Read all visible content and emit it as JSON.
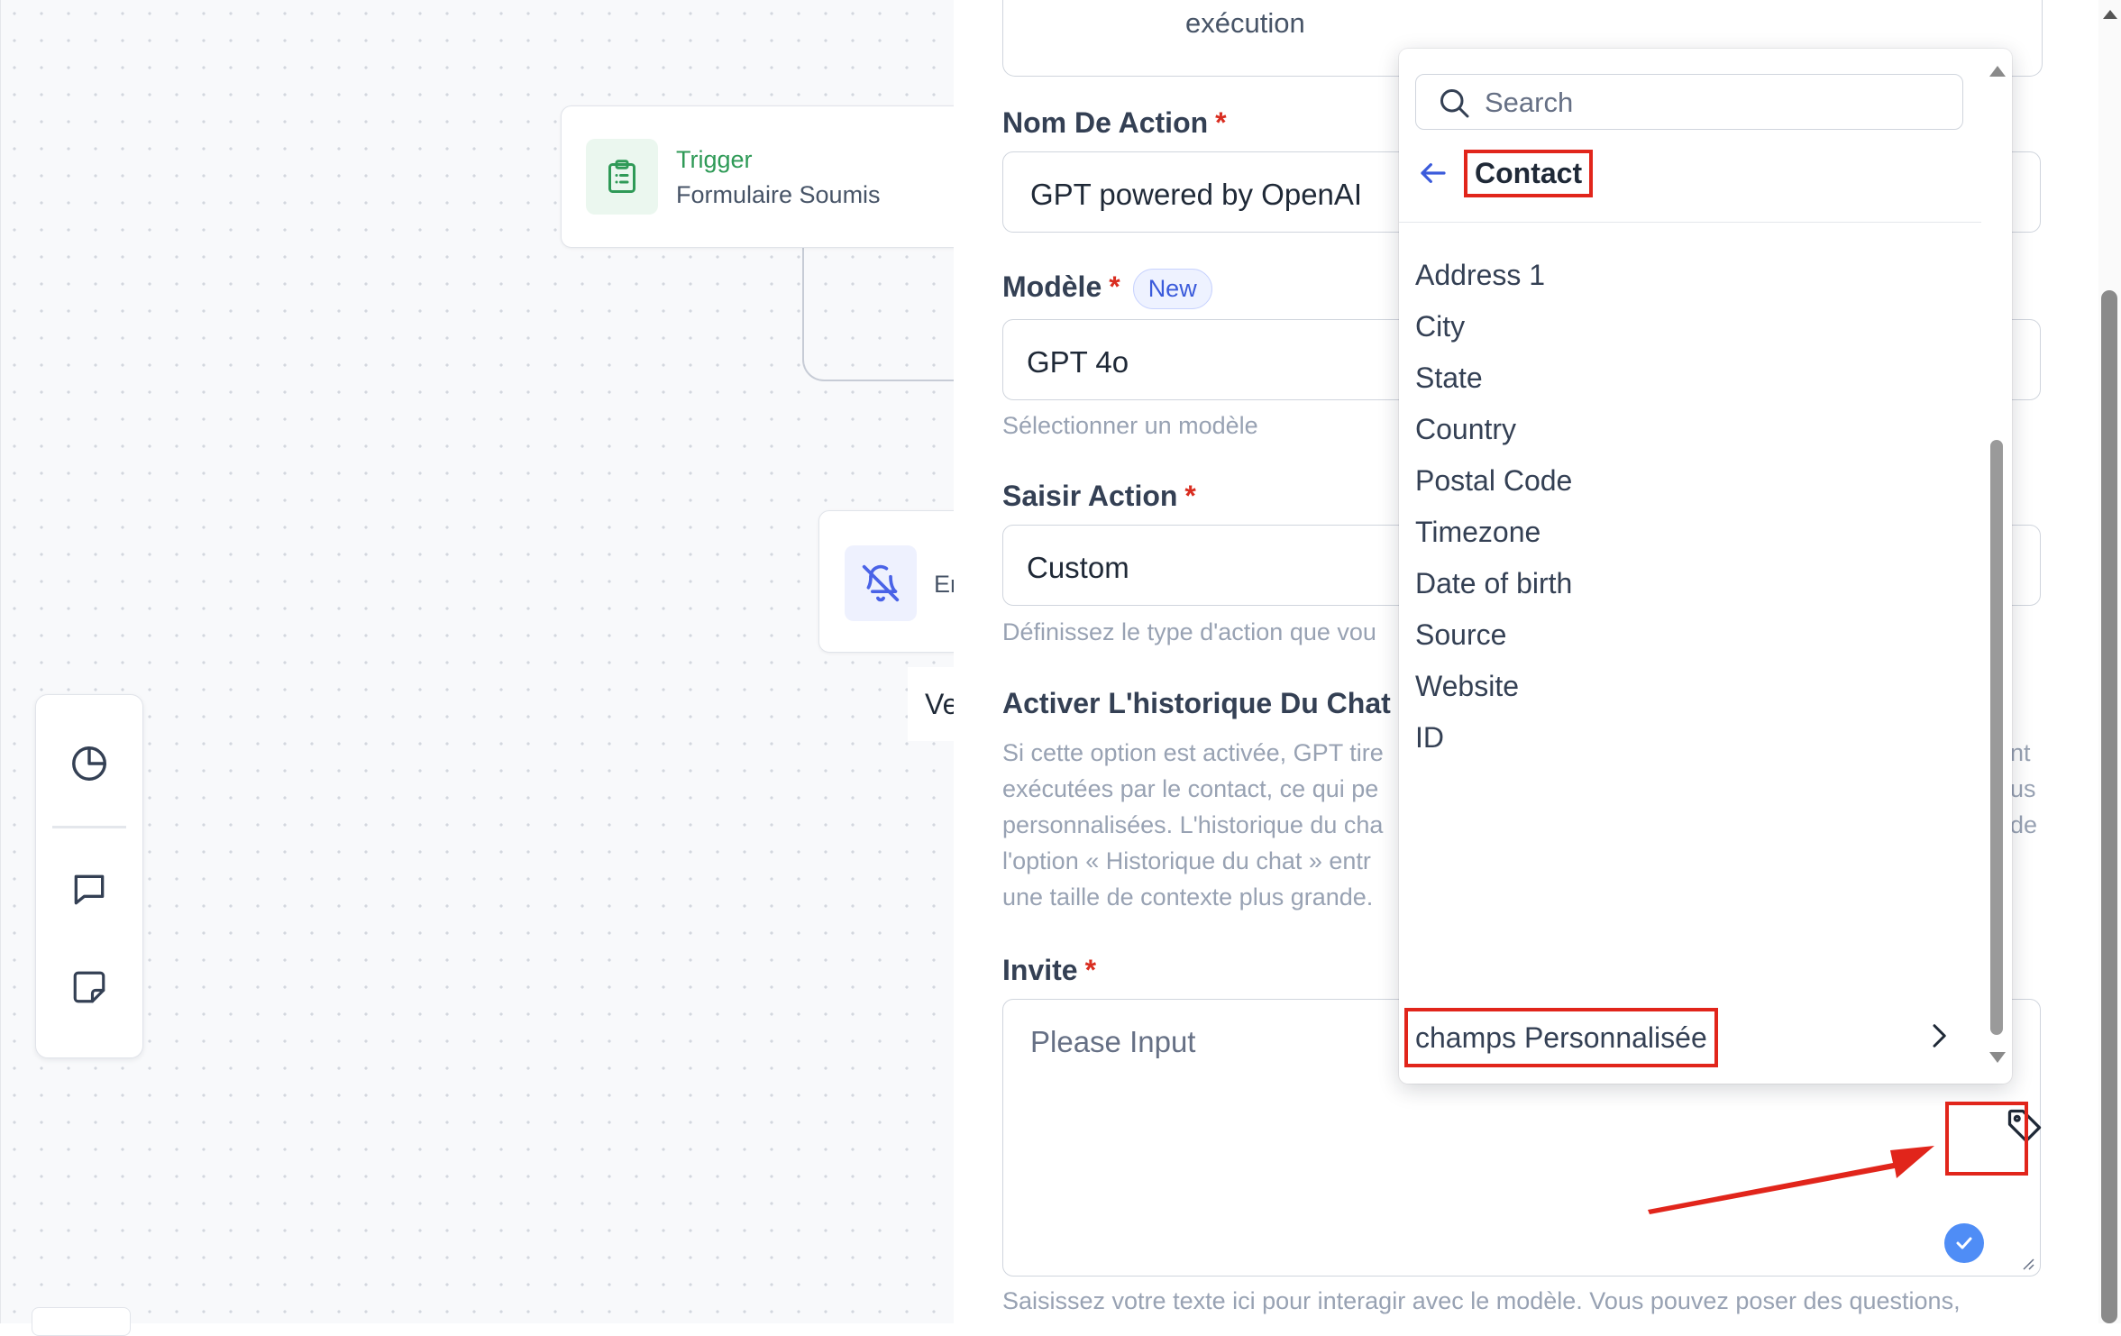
{
  "canvas": {
    "trigger_node": {
      "title": "Trigger",
      "subtitle": "Formulaire Soumis"
    },
    "action_node": {
      "label": "Er"
    },
    "side_chip": "Ve"
  },
  "panel": {
    "top_card_text": "exécution",
    "action_name": {
      "label": "Nom De Action",
      "required": "*",
      "value": "GPT powered by OpenAI"
    },
    "model": {
      "label": "Modèle",
      "required": "*",
      "badge": "New",
      "value": "GPT 4o",
      "help": "Sélectionner un modèle"
    },
    "action_type": {
      "label": "Saisir Action",
      "required": "*",
      "value": "Custom",
      "help": "Définissez le type d'action que vou"
    },
    "chat_history": {
      "label": "Activer L'historique Du Chat",
      "desc_lines": [
        "Si cette option est activée, GPT tire",
        "exécutées par le contact, ce qui pe",
        "personnalisées. L'historique du cha",
        "l'option « Historique du chat » entr",
        "une taille de contexte plus grande."
      ],
      "desc_right": [
        "nt",
        "us",
        "de"
      ]
    },
    "prompt": {
      "label": "Invite",
      "required": "*",
      "placeholder": "Please Input"
    },
    "prompt_help": "Saisissez votre texte ici pour interagir avec le modèle. Vous pouvez poser des questions,"
  },
  "dropdown": {
    "search_placeholder": "Search",
    "header": "Contact",
    "items": [
      "Address 1",
      "City",
      "State",
      "Country",
      "Postal Code",
      "Timezone",
      "Date of birth",
      "Source",
      "Website",
      "ID"
    ],
    "custom_fields": "champs Personnalisée"
  },
  "colors": {
    "highlight": "#e1251b",
    "accent": "#3b5bdb",
    "trigger_green": "#2f9a57",
    "required_red": "#d92d20"
  },
  "icons": [
    "clipboard-icon",
    "bell-off-icon",
    "pie-chart-icon",
    "message-icon",
    "sticky-note-icon",
    "search-icon",
    "arrow-left-icon",
    "chevron-right-icon",
    "tag-icon",
    "check-icon"
  ]
}
